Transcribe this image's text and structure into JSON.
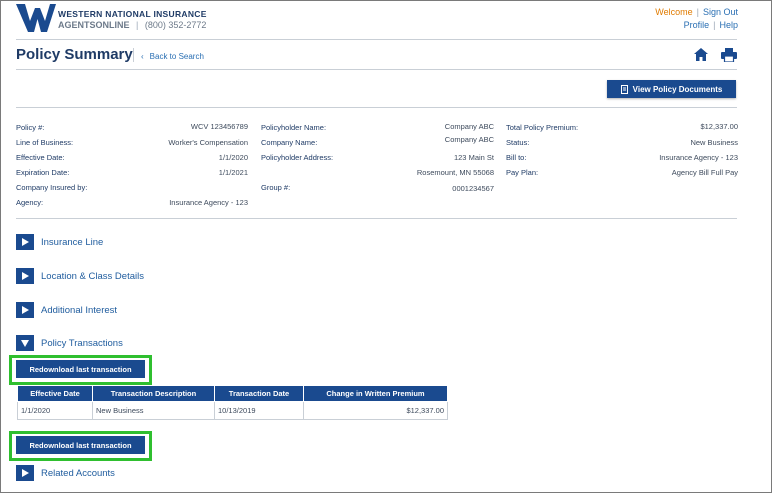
{
  "header": {
    "brand_name": "Western National Insurance",
    "agents_online": "AGENTSONLINE",
    "phone": "(800) 352-2772",
    "welcome": "Welcome",
    "sign_out": "Sign Out",
    "profile": "Profile",
    "help": "Help"
  },
  "page": {
    "title": "Policy Summary",
    "back": "Back to Search",
    "view_docs": "View Policy Documents"
  },
  "summary": {
    "col1": [
      {
        "label": "Policy #:",
        "value": "WCV  123456789"
      },
      {
        "label": "Line of Business:",
        "value": "Worker's Compensation"
      },
      {
        "label": "Effective Date:",
        "value": "1/1/2020"
      },
      {
        "label": "Expiration Date:",
        "value": "1/1/2021"
      },
      {
        "label": "Company Insured by:",
        "value": ""
      },
      {
        "label": "Agency:",
        "value": "Insurance Agency - 123"
      }
    ],
    "col2": [
      {
        "label": "Policyholder Name:",
        "value": "Company ABC"
      },
      {
        "label": "Company Name:",
        "value": "Company ABC"
      },
      {
        "label": "Policyholder Address:",
        "value": "123 Main St"
      },
      {
        "label": "",
        "value": "Rosemount, MN 55068"
      },
      {
        "label": "Group #:",
        "value": "0001234567"
      }
    ],
    "col3": [
      {
        "label": "Total Policy Premium:",
        "value": "$12,337.00"
      },
      {
        "label": "Status:",
        "value": "New Business"
      },
      {
        "label": "Bill to:",
        "value": "Insurance Agency - 123"
      },
      {
        "label": "Pay Plan:",
        "value": "Agency Bill Full Pay"
      }
    ]
  },
  "sections": {
    "insurance_line": "Insurance Line",
    "location_class": "Location & Class Details",
    "additional_interest": "Additional Interest",
    "policy_transactions": "Policy Transactions",
    "related_accounts": "Related Accounts"
  },
  "redownload_label": "Redownload last transaction",
  "transactions": {
    "headers": [
      "Effective Date",
      "Transaction Description",
      "Transaction Date",
      "Change in Written Premium"
    ],
    "rows": [
      [
        "1/1/2020",
        "New Business",
        "10/13/2019",
        "$12,337.00"
      ]
    ]
  },
  "colors": {
    "primary": "#1a4a8f",
    "highlight": "#2fbf2f",
    "welcome": "#e07b00"
  }
}
